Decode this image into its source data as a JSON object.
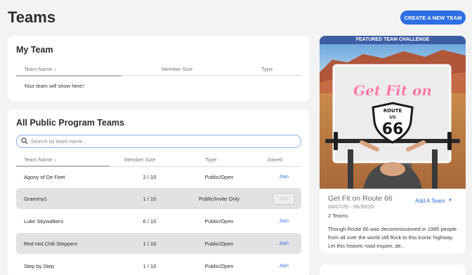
{
  "page": {
    "title": "Teams",
    "create_button": "CREATE A NEW TEAM"
  },
  "my_team": {
    "title": "My Team",
    "columns": [
      "Team Name",
      "Member Size",
      "Type"
    ],
    "sort_icon": "arrow-down-icon",
    "empty_message": "Your team will show here!"
  },
  "public_teams": {
    "title": "All Public Program Teams",
    "search": {
      "placeholder": "Search by team name..."
    },
    "columns": [
      "Team Name",
      "Member Size",
      "Type",
      "Joined"
    ],
    "rows": [
      {
        "name": "Agony of De Feet",
        "size": "2 / 10",
        "type": "Public/Open",
        "join": "Join",
        "join_disabled": false
      },
      {
        "name": "Grammy1",
        "size": "1 / 10",
        "type": "Public/Invite Only",
        "join": "Join",
        "join_disabled": true
      },
      {
        "name": "Luke Skywalkers",
        "size": "6 / 10",
        "type": "Public/Open",
        "join": "Join",
        "join_disabled": false
      },
      {
        "name": "Red Hot Chili Steppers",
        "size": "1 / 10",
        "type": "Public/Open",
        "join": "Join",
        "join_disabled": false
      },
      {
        "name": "Step by Step",
        "size": "1 / 10",
        "type": "Public/Open",
        "join": "Join",
        "join_disabled": false
      }
    ]
  },
  "featured": {
    "header": "FEATURED TEAM CHALLENGE",
    "sign_text": "Get Fit on",
    "shield_route": "ROUTE",
    "shield_us": "US",
    "shield_number": "66",
    "title": "Get Fit on Route 66",
    "dates": "04/07/25 - 06/30/25",
    "team_count": "2 Teams",
    "add_team": "Add A Team",
    "description": "Though Route 66 was decommissioned in 1985 people from all over the world still flock to this iconic highway. Let this historic road inspire, de..."
  },
  "colors": {
    "accent": "#2f6fe4",
    "featured_header": "#3d5ea5",
    "row_shade": "#e2e2e3",
    "neon_pink": "#ff6f9c"
  }
}
